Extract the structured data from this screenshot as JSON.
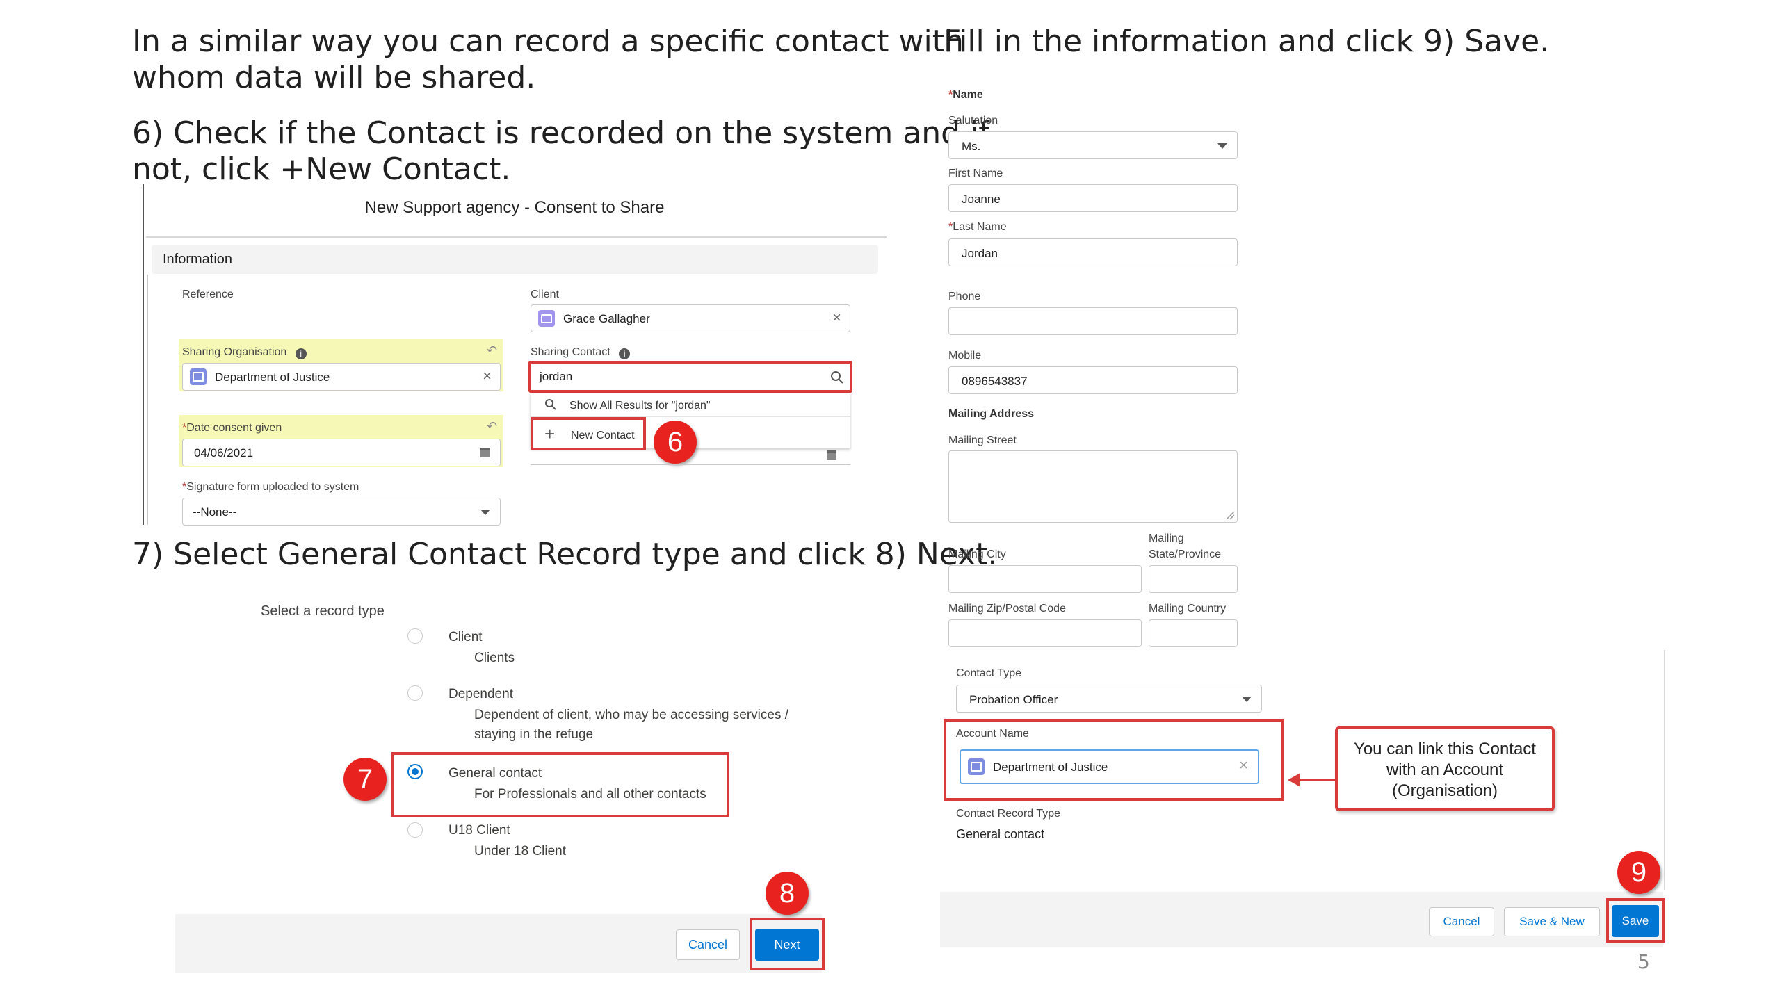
{
  "instructions": {
    "intro_line1": "In a similar way you can record a specific contact with",
    "intro_line2": "whom data will be shared.",
    "step6_line1": "6) Check if the Contact is recorded on the system and if",
    "step6_line2": "not, click +New Contact.",
    "step7": "7) Select General Contact Record type and click 8) Next.",
    "right_title": "Fill in the information and click 9) Save."
  },
  "consent_form": {
    "title": "New Support agency - Consent to Share",
    "section": "Information",
    "reference_label": "Reference",
    "client_label": "Client",
    "client_value": "Grace Gallagher",
    "sharing_org_label": "Sharing Organisation",
    "sharing_org_value": "Department of Justice",
    "sharing_contact_label": "Sharing Contact",
    "sharing_contact_value": "jordan",
    "show_all_results": "Show All Results for \"jordan\"",
    "new_contact": "New Contact",
    "date_label": "Date consent given",
    "date_value": "04/06/2021",
    "signature_label": "Signature form uploaded to system",
    "signature_value": "--None--"
  },
  "record_type": {
    "prompt": "Select a record type",
    "options": [
      {
        "name": "Client",
        "desc": "Clients",
        "selected": false
      },
      {
        "name": "Dependent",
        "desc": "Dependent of client, who may be accessing services /",
        "desc2": "staying in the refuge",
        "selected": false
      },
      {
        "name": "General contact",
        "desc": "For Professionals and all other contacts",
        "selected": true
      },
      {
        "name": "U18 Client",
        "desc": "Under 18 Client",
        "selected": false
      }
    ],
    "cancel": "Cancel",
    "next": "Next"
  },
  "contact_form": {
    "name_heading": "Name",
    "salutation_label": "Salutation",
    "salutation_value": "Ms.",
    "first_name_label": "First Name",
    "first_name_value": "Joanne",
    "last_name_label": "Last Name",
    "last_name_value": "Jordan",
    "phone_label": "Phone",
    "phone_value": "",
    "mobile_label": "Mobile",
    "mobile_value": "0896543837",
    "mailing_address_heading": "Mailing Address",
    "mailing_street_label": "Mailing Street",
    "mailing_city_label": "Mailing City",
    "mailing_state_label_1": "Mailing",
    "mailing_state_label_2": "State/Province",
    "mailing_zip_label": "Mailing Zip/Postal Code",
    "mailing_country_label": "Mailing Country",
    "contact_type_label": "Contact Type",
    "contact_type_value": "Probation Officer",
    "account_name_label": "Account Name",
    "account_name_value": "Department of Justice",
    "record_type_label": "Contact Record Type",
    "record_type_value": "General contact",
    "callout_line1": "You can link this Contact",
    "callout_line2": "with an Account",
    "callout_line3": "(Organisation)",
    "cancel": "Cancel",
    "save_new": "Save & New",
    "save": "Save"
  },
  "badges": {
    "b6": "6",
    "b7": "7",
    "b8": "8",
    "b9": "9"
  },
  "page_number": "5",
  "colors": {
    "brand": "#0176d3",
    "highlight": "#f6f8b5",
    "callout_red": "#d93a3a",
    "badge_red": "#e8231f"
  }
}
